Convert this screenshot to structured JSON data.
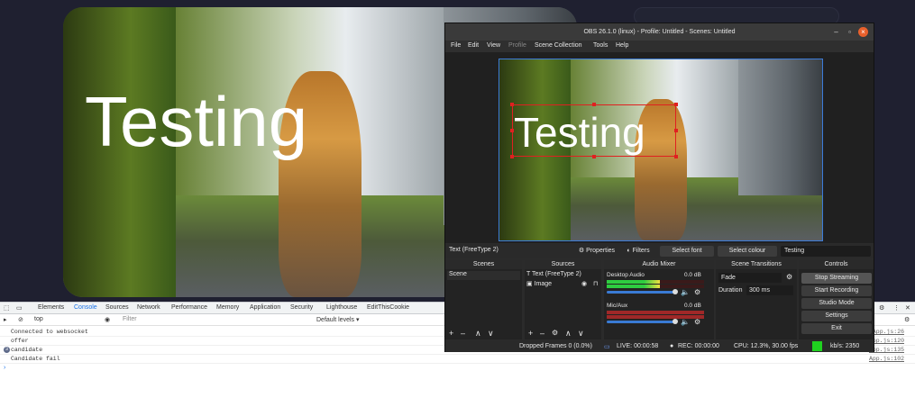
{
  "video": {
    "overlay_text": "Testing"
  },
  "obs": {
    "title": "OBS 26.1.0 (linux) - Profile: Untitled - Scenes: Untitled",
    "menu": [
      "File",
      "Edit",
      "View",
      "Profile",
      "Scene Collection",
      "Tools",
      "Help"
    ],
    "preview_text": "Testing",
    "source_bar": {
      "name": "Text (FreeType 2)",
      "properties": "Properties",
      "filters": "Filters",
      "select_font": "Select font",
      "select_colour": "Select colour",
      "text_value": "Testing"
    },
    "scenes": {
      "title": "Scenes",
      "items": [
        "Scene"
      ]
    },
    "sources": {
      "title": "Sources",
      "items": [
        "Text (FreeType 2)",
        "Image"
      ]
    },
    "mixer": {
      "title": "Audio Mixer",
      "channels": [
        {
          "name": "Desktop Audio",
          "db": "0.0 dB",
          "level": 0.55
        },
        {
          "name": "Mic/Aux",
          "db": "0.0 dB",
          "level": 0.0
        }
      ]
    },
    "transitions": {
      "title": "Scene Transitions",
      "type": "Fade",
      "duration_label": "Duration",
      "duration": "300 ms"
    },
    "controls": {
      "title": "Controls",
      "buttons": [
        "Stop Streaming",
        "Start Recording",
        "Studio Mode",
        "Settings",
        "Exit"
      ]
    },
    "status": {
      "dropped": "Dropped Frames 0 (0.0%)",
      "live": "LIVE: 00:00:58",
      "rec": "REC: 00:00:00",
      "cpu": "CPU: 12.3%, 30.00 fps",
      "kbps": "kb/s: 2350",
      "accent": "#1fd11f"
    }
  },
  "devtools": {
    "tabs": [
      "Elements",
      "Console",
      "Sources",
      "Network",
      "Performance",
      "Memory",
      "Application",
      "Security",
      "Lighthouse",
      "EditThisCookie"
    ],
    "context": "top",
    "filter_placeholder": "Filter",
    "levels": "Default levels ▾",
    "logs": [
      {
        "msg": "Connected to websocket",
        "src": "App.js:26",
        "count": ""
      },
      {
        "msg": "offer",
        "src": "App.js:120",
        "count": ""
      },
      {
        "msg": "candidate",
        "src": "App.js:135",
        "count": "3"
      },
      {
        "msg": "Candidate fail",
        "src": "App.js:102",
        "count": ""
      }
    ]
  }
}
